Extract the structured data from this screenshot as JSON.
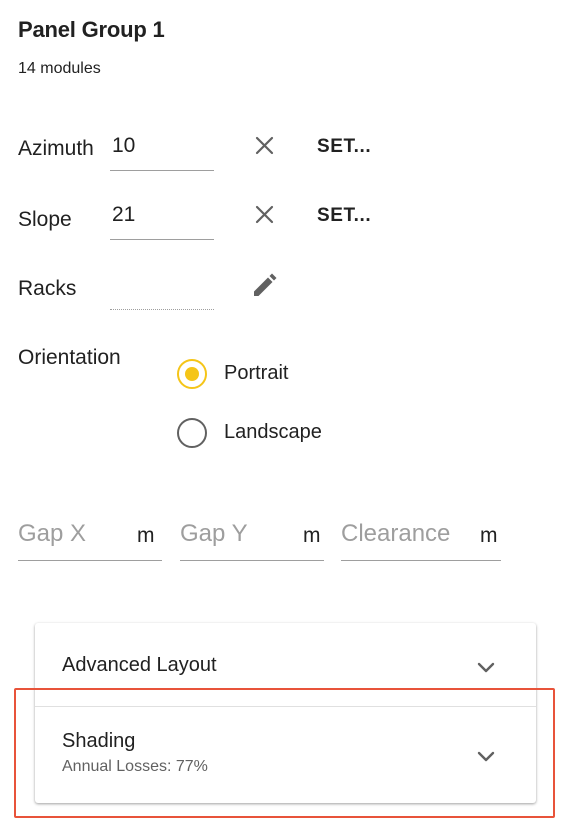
{
  "header": {
    "title": "Panel Group 1",
    "subtitle": "14 modules"
  },
  "fields": {
    "azimuth": {
      "label": "Azimuth",
      "value": "10",
      "set_label": "SET..."
    },
    "slope": {
      "label": "Slope",
      "value": "21",
      "set_label": "SET..."
    },
    "racks": {
      "label": "Racks",
      "value": ""
    }
  },
  "orientation": {
    "label": "Orientation",
    "options": [
      {
        "label": "Portrait",
        "selected": true
      },
      {
        "label": "Landscape",
        "selected": false
      }
    ]
  },
  "spacing": {
    "gap_x": {
      "label": "Gap X",
      "unit": "m"
    },
    "gap_y": {
      "label": "Gap Y",
      "unit": "m"
    },
    "clearance": {
      "label": "Clearance",
      "unit": "m"
    }
  },
  "panels": [
    {
      "title": "Advanced Layout",
      "subtitle": ""
    },
    {
      "title": "Shading",
      "subtitle": "Annual Losses: 77%"
    }
  ],
  "colors": {
    "accent": "#f5c518",
    "highlight": "#e8533a",
    "underline": "#9e9e9e",
    "muted": "#9e9e9e"
  },
  "icons": {
    "clear": "close-icon",
    "edit": "pencil-icon",
    "expand": "chevron-down-icon"
  }
}
